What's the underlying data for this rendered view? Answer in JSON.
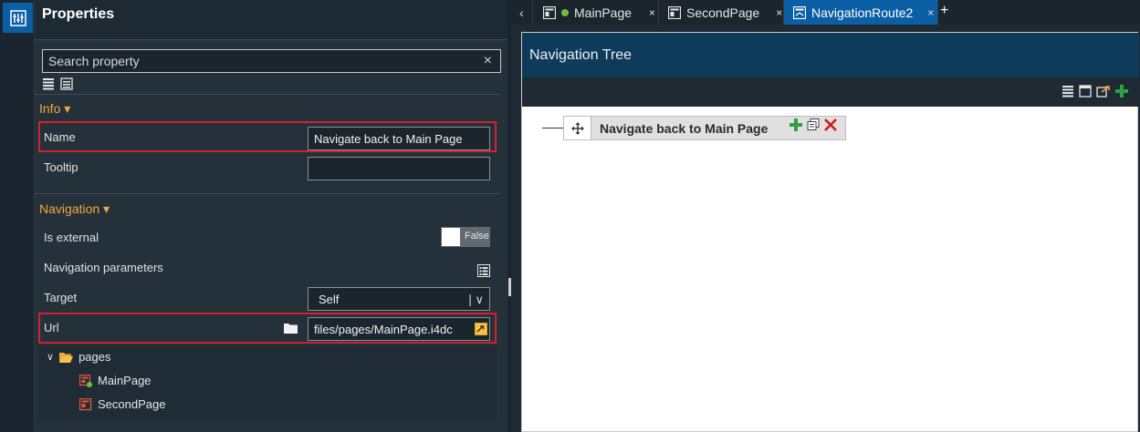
{
  "panel": {
    "title": "Properties",
    "search": {
      "placeholder": "Search property",
      "clear": "×"
    }
  },
  "info_section": {
    "header": "Info ▾",
    "name_label": "Name",
    "name_value": "Navigate back to Main Page",
    "tooltip_label": "Tooltip",
    "tooltip_value": ""
  },
  "navigation_section": {
    "header": "Navigation ▾",
    "is_external_label": "Is external",
    "is_external_value": "False",
    "params_label": "Navigation parameters",
    "target_label": "Target",
    "target_value": "Self",
    "url_label": "Url",
    "url_value": "files/pages/MainPage.i4dc"
  },
  "file_tree": {
    "folder": "pages",
    "items": [
      "MainPage",
      "SecondPage"
    ]
  },
  "tabs": [
    {
      "label": "MainPage",
      "close": "×"
    },
    {
      "label": "SecondPage",
      "close": "×"
    },
    {
      "label": "NavigationRoute2",
      "close": "×"
    }
  ],
  "tab_add": "+",
  "editor": {
    "title": "Navigation Tree",
    "node_label": "Navigate back to Main Page"
  },
  "colors": {
    "accent": "#0b5fa5",
    "section_header": "#f0a93b",
    "highlight_border": "#d1222a",
    "editor_header": "#0f3b5a",
    "add_green": "#2ea043",
    "delete_red": "#d11a1a"
  }
}
